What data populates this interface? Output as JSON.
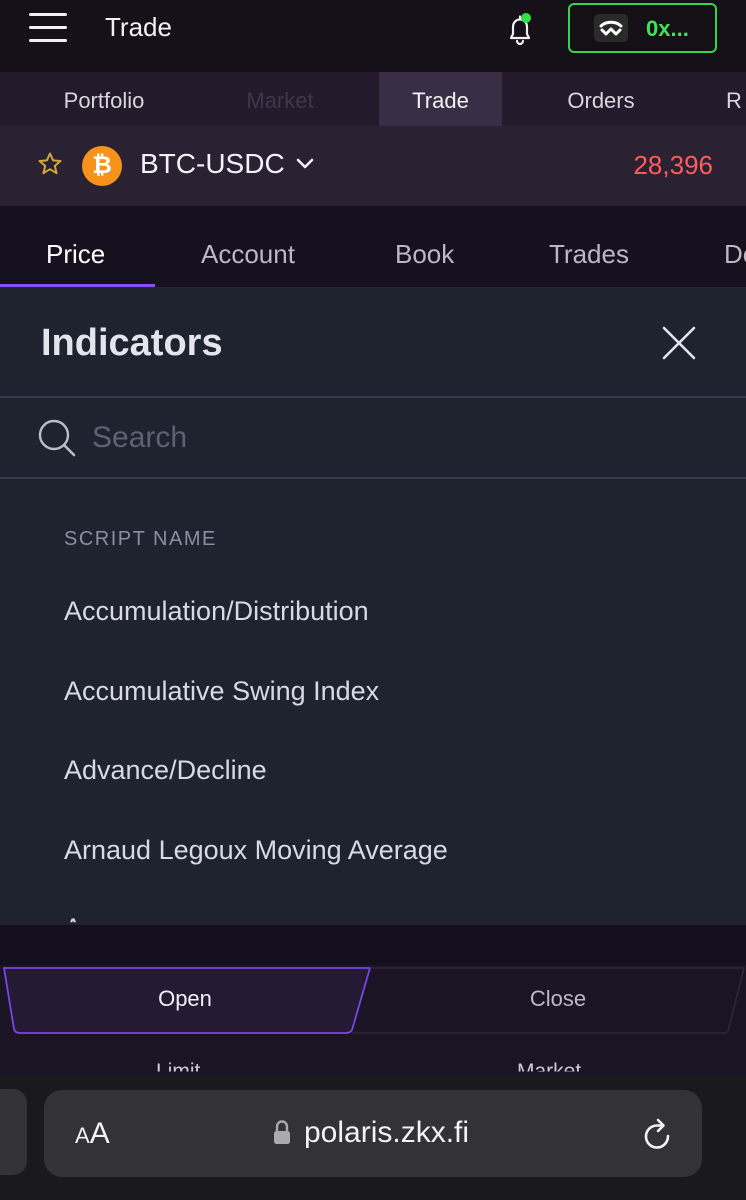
{
  "header": {
    "title": "Trade",
    "wallet_label": "0x..."
  },
  "nav": {
    "tabs": [
      {
        "label": "Portfolio"
      },
      {
        "label": "Market"
      },
      {
        "label": "Trade"
      },
      {
        "label": "Orders"
      },
      {
        "label": "R"
      }
    ],
    "active": "Trade"
  },
  "market": {
    "pair": "BTC-USDC",
    "coin_symbol": "₿",
    "price": "28,396",
    "price_color": "#ff5b5b"
  },
  "chart_tabs": {
    "tabs": [
      {
        "label": "Price"
      },
      {
        "label": "Account"
      },
      {
        "label": "Book"
      },
      {
        "label": "Trades"
      },
      {
        "label": "De"
      }
    ],
    "active": "Price"
  },
  "indicators": {
    "title": "Indicators",
    "search_placeholder": "Search",
    "section_label": "SCRIPT NAME",
    "items": [
      "Accumulation/Distribution",
      "Accumulative Swing Index",
      "Advance/Decline",
      "Arnaud Legoux Moving Average",
      "Aroon"
    ]
  },
  "trade": {
    "open_label": "Open",
    "close_label": "Close",
    "order_types": [
      "Limit",
      "Market"
    ]
  },
  "browser": {
    "text_size_small": "A",
    "text_size_large": "A",
    "url": "polaris.zkx.fi"
  },
  "colors": {
    "accent": "#8a4dff",
    "wallet_green": "#3ee356",
    "btc_orange": "#f7931a"
  }
}
